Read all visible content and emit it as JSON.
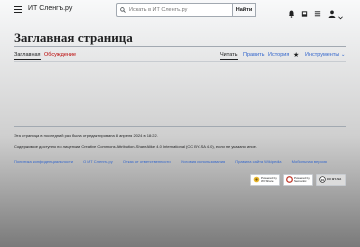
{
  "header": {
    "site_name": "ИТ Сленгъ.ру",
    "search_placeholder": "Искать в ИТ Сленгъ.ру",
    "search_button": "Найти"
  },
  "page": {
    "title": "Заглавная страница"
  },
  "tabs": {
    "main": "Заглавная",
    "talk": "Обсуждение",
    "read": "Читать",
    "edit": "Править",
    "history": "История",
    "tools": "Инструменты"
  },
  "footer": {
    "last_edited": "Эта страница в последний раз была отредактирована 8 апреля 2024 в 18:22.",
    "license": "Содержимое доступно по лицензии Creative Commons Attribution-ShareAlike 4.0 International (CC BY-SA 4.0), если не указано иное.",
    "links": [
      "Политика конфиденциальности",
      "О ИТ Сленгъ.ру",
      "Отказ от ответственности",
      "Условия использования",
      "Правила сайта Wikipedia",
      "Мобильная версия"
    ],
    "badges": [
      "Powered by WI Share",
      "Powered by Semantic",
      "CC BY-SA"
    ]
  },
  "colors": {
    "link": "#3366cc",
    "link_new": "#ba0000",
    "text": "#202122"
  }
}
